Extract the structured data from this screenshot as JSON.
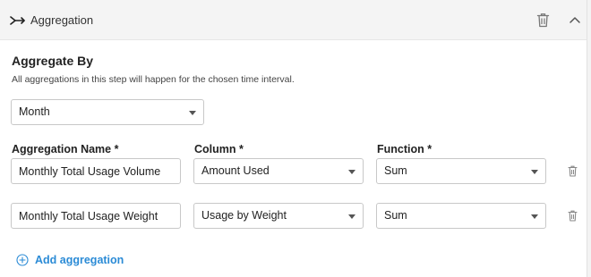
{
  "header": {
    "icon": "merge-arrow-icon",
    "title": "Aggregation",
    "delete_icon": "trash-icon",
    "collapse_icon": "chevron-up-icon"
  },
  "aggregate_by": {
    "title": "Aggregate By",
    "description": "All aggregations in this step will happen for the chosen time interval.",
    "selected": "Month"
  },
  "columns": {
    "name_label": "Aggregation Name *",
    "column_label": "Column *",
    "function_label": "Function *"
  },
  "rows": [
    {
      "name": "Monthly Total Usage Volume",
      "column": "Amount Used",
      "function": "Sum"
    },
    {
      "name": "Monthly Total Usage Weight",
      "column": "Usage by Weight",
      "function": "Sum"
    }
  ],
  "add_aggregation": {
    "label": "Add aggregation",
    "icon": "plus-circle-icon"
  },
  "colors": {
    "accent": "#2b8bd6",
    "header_bg": "#f4f4f4"
  }
}
